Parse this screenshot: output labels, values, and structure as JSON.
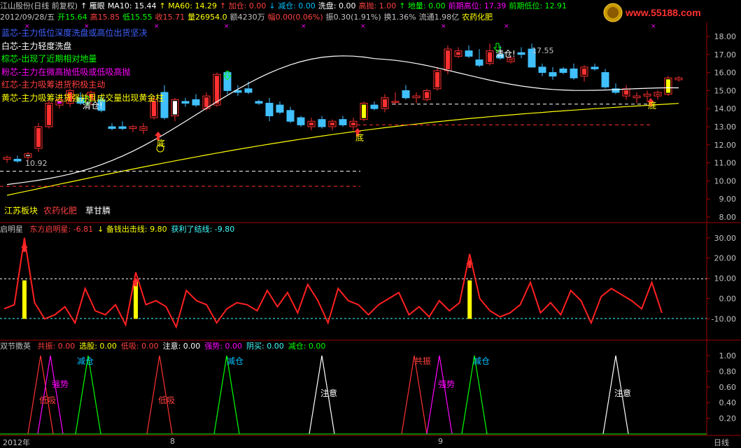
{
  "header": {
    "row1": [
      {
        "text": "江山股份(日线 前复权)",
        "color": "#c0c0c0"
      },
      {
        "text": "↑ 雁眼",
        "color": "#ffffff"
      },
      {
        "text": "MA10: 15.44",
        "color": "#ffffff"
      },
      {
        "text": "↑ MA60: 14.29",
        "color": "#ffff00"
      },
      {
        "text": "↑ 加仓: 0.00",
        "color": "#ff4040"
      },
      {
        "text": "↓ 减仓: 0.00",
        "color": "#00c0ff"
      },
      {
        "text": "洗盘: 0.00",
        "color": "#ffffff"
      },
      {
        "text": "高抛: 1.00",
        "color": "#ff4040"
      },
      {
        "text": "↑ 地量: 0.00",
        "color": "#00ff00"
      },
      {
        "text": "前期高位: 17.39",
        "color": "#ff00ff"
      },
      {
        "text": "前期低位: 12.91",
        "color": "#00ff00"
      }
    ],
    "row2": [
      {
        "text": "2012/09/28/五",
        "color": "#c0c0c0"
      },
      {
        "text": "开15.64",
        "color": "#00ff00"
      },
      {
        "text": "高15.85",
        "color": "#ff4040"
      },
      {
        "text": "低15.55",
        "color": "#00ff00"
      },
      {
        "text": "收15.71",
        "color": "#ff4040"
      },
      {
        "text": "量26954.0",
        "color": "#ffff00"
      },
      {
        "text": "额4230万",
        "color": "#c0c0c0"
      },
      {
        "text": "幅0.00(0.06%)",
        "color": "#ff4040"
      },
      {
        "text": "振0.30(1.91%)",
        "color": "#c0c0c0"
      },
      {
        "text": "换1.36%",
        "color": "#c0c0c0"
      },
      {
        "text": "流通1.98亿",
        "color": "#c0c0c0"
      },
      {
        "text": "农药化肥",
        "color": "#ffff00"
      }
    ]
  },
  "legend": [
    {
      "text": "蓝芯-主力低位深度洗盘或高位出货坚决",
      "color": "#4060ff"
    },
    {
      "text": "白芯-主力轻度洗盘",
      "color": "#ffffff"
    },
    {
      "text": "棕芯-出现了近期相对地量",
      "color": "#00ff00"
    },
    {
      "text": "粉芯-主力在微高抛低吸或低吸高抛",
      "color": "#ff00ff"
    },
    {
      "text": "红芯-主力吸筹进货积极主动",
      "color": "#ff4040"
    },
    {
      "text": "黄芯-主力吸筹进货强并且成交量出现黄金柱",
      "color": "#ffff00"
    }
  ],
  "main_axis": [
    "18.00",
    "17.00",
    "16.00",
    "15.00",
    "14.00",
    "13.00",
    "12.00",
    "11.00",
    "10.00",
    "9.00",
    "8.00"
  ],
  "annotations": {
    "qingcang": "清仓!",
    "di": "底",
    "low_price": "10.92",
    "high_price": "17.55"
  },
  "sector": {
    "a": "江苏板块",
    "b": "农药化肥",
    "c": "草甘膦"
  },
  "panel2": {
    "title": "启明星",
    "items": [
      {
        "text": "东方启明星: -6.81",
        "color": "#ff4040"
      },
      {
        "text": "↓ 备钱出击线: 9.80",
        "color": "#ffff00"
      },
      {
        "text": "获利了结线: -9.80",
        "color": "#40ffff"
      }
    ],
    "axis": [
      "30.00",
      "20.00",
      "10.00",
      "0.00",
      "-10.00"
    ]
  },
  "panel3": {
    "title": "双节擞英",
    "items": [
      {
        "text": "共振: 0.00",
        "color": "#ff4040"
      },
      {
        "text": "选股: 0.00",
        "color": "#ffff00"
      },
      {
        "text": "低吸: 0.00",
        "color": "#ff4040"
      },
      {
        "text": "注意: 0.00",
        "color": "#ffffff"
      },
      {
        "text": "强势: 0.00",
        "color": "#ff00ff"
      },
      {
        "text": "阴买: 0.00",
        "color": "#40ffff"
      },
      {
        "text": "减仓: 0.00",
        "color": "#00ff00"
      }
    ],
    "axis": [
      "1.00",
      "0.80",
      "0.60",
      "0.40",
      "0.20"
    ],
    "labels": {
      "dixi": "低吸",
      "qiangshi": "强势",
      "jiancang": "减仓",
      "zhuyi": "注意",
      "gongzhen": "共振"
    }
  },
  "xaxis": {
    "year": "2012年",
    "m8": "8",
    "m9": "9",
    "period": "日线"
  },
  "logo_text": "www.55188.com",
  "chart_data": [
    {
      "type": "candlestick",
      "title": "江山股份(日线 前复权)",
      "ylim": [
        8,
        18.5
      ],
      "candles": [
        [
          11.2,
          11.4,
          11.0,
          11.3
        ],
        [
          11.2,
          11.4,
          11.0,
          11.1
        ],
        [
          11.3,
          11.6,
          11.1,
          11.5
        ],
        [
          11.8,
          13.2,
          11.6,
          13.0
        ],
        [
          13.0,
          14.5,
          12.9,
          14.3
        ],
        [
          14.2,
          14.8,
          14.0,
          14.5
        ],
        [
          14.3,
          15.1,
          14.1,
          15.0
        ],
        [
          14.6,
          14.9,
          14.2,
          14.3
        ],
        [
          14.5,
          15.0,
          14.2,
          14.9
        ],
        [
          14.5,
          14.7,
          13.8,
          13.9
        ],
        [
          13.0,
          13.2,
          12.8,
          12.9
        ],
        [
          13.0,
          13.3,
          12.8,
          12.9
        ],
        [
          12.9,
          13.1,
          12.7,
          13.0
        ],
        [
          12.8,
          13.2,
          12.6,
          13.0
        ],
        [
          13.5,
          14.7,
          13.4,
          14.5
        ],
        [
          14.9,
          15.3,
          13.4,
          13.5
        ],
        [
          13.6,
          14.6,
          13.3,
          14.5
        ],
        [
          14.4,
          14.6,
          14.1,
          14.3
        ],
        [
          14.5,
          14.8,
          14.1,
          14.2
        ],
        [
          14.0,
          14.9,
          13.9,
          14.7
        ],
        [
          14.2,
          16.0,
          14.1,
          15.9
        ],
        [
          16.0,
          16.1,
          14.8,
          15.0
        ],
        [
          15.0,
          15.3,
          14.7,
          14.9
        ],
        [
          15.1,
          15.5,
          14.8,
          14.9
        ],
        [
          14.4,
          14.5,
          14.2,
          14.3
        ],
        [
          14.3,
          14.6,
          13.3,
          13.6
        ],
        [
          14.2,
          14.4,
          13.7,
          13.8
        ],
        [
          13.9,
          14.1,
          13.2,
          13.3
        ],
        [
          13.5,
          13.6,
          13.0,
          13.1
        ],
        [
          13.0,
          13.5,
          12.8,
          13.3
        ],
        [
          13.4,
          13.6,
          12.9,
          13.0
        ],
        [
          13.0,
          13.4,
          12.8,
          13.3
        ],
        [
          13.4,
          13.6,
          13.0,
          13.1
        ],
        [
          13.0,
          13.5,
          12.8,
          13.3
        ],
        [
          13.4,
          14.4,
          13.3,
          14.3
        ],
        [
          14.2,
          14.4,
          13.9,
          14.0
        ],
        [
          14.0,
          14.8,
          13.8,
          14.6
        ],
        [
          14.4,
          14.9,
          14.2,
          14.4
        ],
        [
          15.0,
          15.3,
          14.5,
          14.6
        ],
        [
          14.6,
          14.9,
          14.3,
          14.7
        ],
        [
          14.5,
          15.1,
          14.4,
          15.0
        ],
        [
          15.1,
          16.3,
          15.0,
          16.1
        ],
        [
          16.1,
          17.5,
          15.9,
          17.3
        ],
        [
          16.9,
          17.4,
          16.8,
          17.2
        ],
        [
          17.2,
          17.5,
          16.8,
          16.9
        ],
        [
          16.7,
          17.3,
          16.3,
          16.4
        ],
        [
          16.5,
          17.6,
          16.4,
          17.2
        ],
        [
          17.0,
          17.5,
          16.7,
          16.8
        ],
        [
          16.6,
          16.9,
          16.5,
          16.8
        ],
        [
          17.1,
          17.4,
          16.8,
          17.0
        ],
        [
          17.3,
          17.6,
          16.3,
          16.3
        ],
        [
          16.3,
          16.5,
          15.8,
          16.0
        ],
        [
          16.0,
          16.3,
          15.6,
          15.8
        ],
        [
          16.2,
          16.3,
          15.9,
          16.0
        ],
        [
          16.2,
          16.5,
          15.6,
          15.7
        ],
        [
          15.8,
          16.4,
          15.5,
          16.3
        ],
        [
          16.3,
          16.5,
          16.1,
          16.2
        ],
        [
          16.0,
          16.2,
          15.1,
          15.2
        ],
        [
          15.1,
          15.4,
          14.8,
          14.9
        ],
        [
          14.7,
          15.3,
          14.5,
          15.1
        ],
        [
          14.6,
          14.9,
          14.3,
          14.7
        ],
        [
          14.7,
          15.0,
          14.4,
          14.8
        ],
        [
          14.7,
          15.0,
          14.5,
          14.9
        ],
        [
          14.8,
          15.8,
          14.7,
          15.7
        ],
        [
          15.6,
          15.8,
          15.5,
          15.7
        ]
      ],
      "ma10_start_end": [
        9.8,
        15.44
      ],
      "ma60_start_end": [
        9.2,
        14.29
      ]
    },
    {
      "type": "line",
      "title": "启明星",
      "series": [
        {
          "name": "东方启明星",
          "values": [
            -5,
            -3,
            30,
            -2,
            -10,
            -8,
            -4,
            -12,
            5,
            -6,
            -8,
            -3,
            -13,
            13,
            -3,
            -1,
            -4,
            -14,
            4,
            -1,
            -3,
            -12,
            -5,
            -2,
            -3,
            -6,
            4,
            -4,
            3,
            -7,
            7,
            -1,
            -12,
            5,
            -1,
            -3,
            -8,
            -3,
            0,
            3,
            -8,
            -4,
            -9,
            -1,
            -6,
            -2,
            22,
            0,
            -6,
            -9,
            -7,
            -3,
            8,
            -7,
            -2,
            -8,
            4,
            -1,
            -12,
            1,
            5,
            2,
            -1,
            -5,
            8,
            -7
          ]
        }
      ],
      "ylim": [
        -15,
        32
      ],
      "hlines": [
        9.8,
        -9.8
      ]
    }
  ]
}
